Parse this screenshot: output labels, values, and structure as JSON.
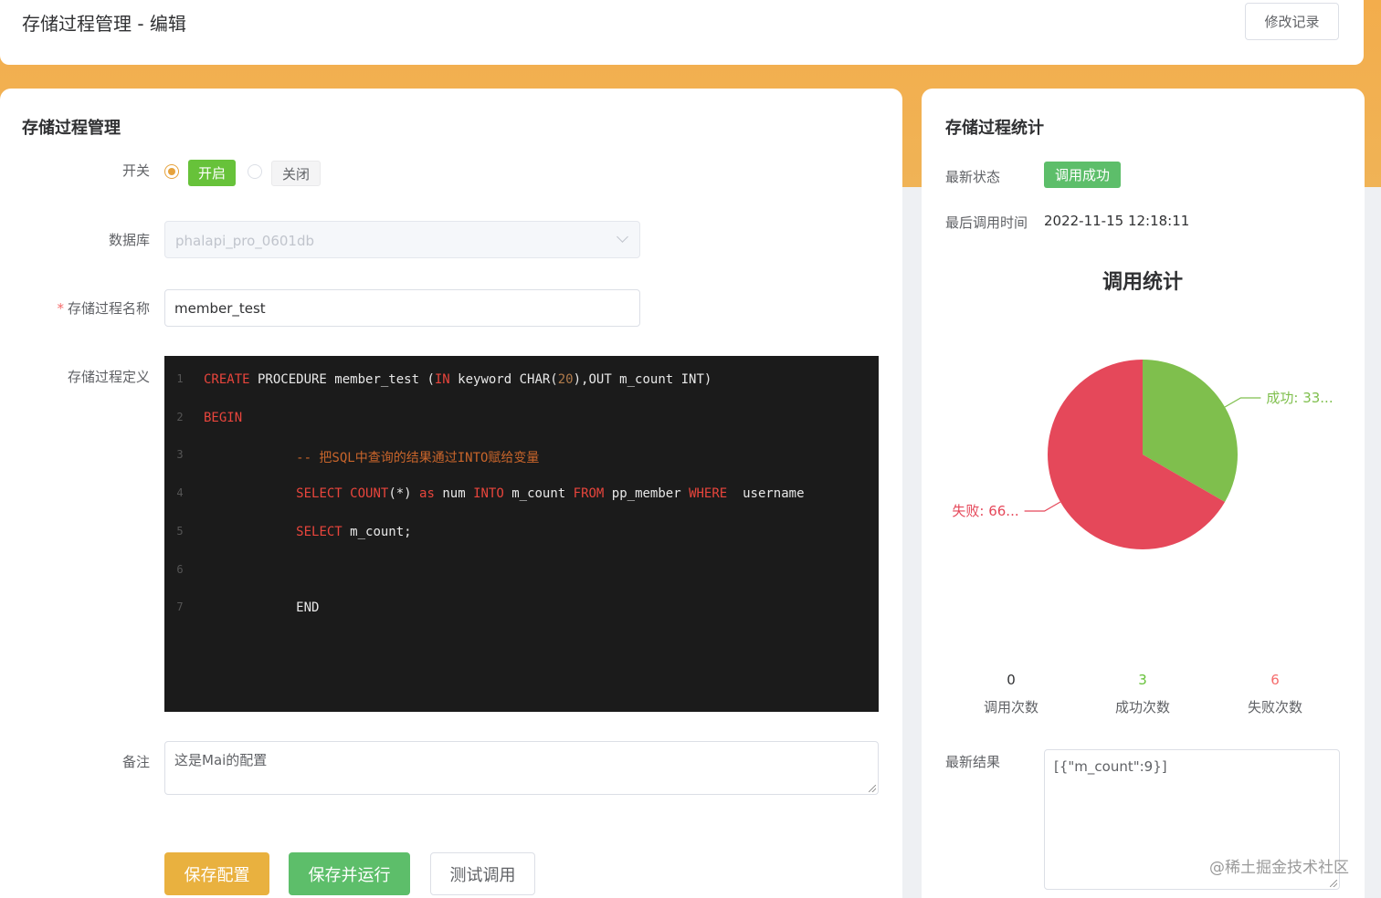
{
  "header": {
    "title": "存储过程管理 - 编辑",
    "history_label": "修改记录"
  },
  "form": {
    "card_title": "存储过程管理",
    "switch_label": "开关",
    "switch_on": "开启",
    "switch_off": "关闭",
    "switch_value": "开启",
    "database_label": "数据库",
    "database_value": "phalapi_pro_0601db",
    "name_label": "存储过程名称",
    "name_required": "*",
    "name_value": "member_test",
    "definition_label": "存储过程定义",
    "code_lines": [
      [
        {
          "t": "CREATE",
          "c": "kw"
        },
        {
          "t": " PROCEDURE member_test ("
        },
        {
          "t": "IN",
          "c": "kw"
        },
        {
          "t": " keyword CHAR("
        },
        {
          "t": "20",
          "c": "num"
        },
        {
          "t": "),OUT m_count INT)"
        }
      ],
      [
        {
          "t": "BEGIN",
          "c": "kw"
        }
      ],
      [
        {
          "t": "            -- 把SQL中查询的结果通过INTO赋给变量",
          "c": "cm"
        }
      ],
      [
        {
          "t": "            "
        },
        {
          "t": "SELECT",
          "c": "kw"
        },
        {
          "t": " "
        },
        {
          "t": "COUNT",
          "c": "kw"
        },
        {
          "t": "(*) "
        },
        {
          "t": "as",
          "c": "kw"
        },
        {
          "t": " num "
        },
        {
          "t": "INTO",
          "c": "kw"
        },
        {
          "t": " m_count "
        },
        {
          "t": "FROM",
          "c": "kw"
        },
        {
          "t": " pp_member "
        },
        {
          "t": "WHERE",
          "c": "kw"
        },
        {
          "t": "  username"
        }
      ],
      [
        {
          "t": "            "
        },
        {
          "t": "SELECT",
          "c": "kw"
        },
        {
          "t": " m_count;"
        }
      ],
      [
        {
          "t": ""
        }
      ],
      [
        {
          "t": "            END"
        }
      ]
    ],
    "remark_label": "备注",
    "remark_value": "这是Mai的配置",
    "save_label": "保存配置",
    "save_run_label": "保存并运行",
    "test_label": "测试调用"
  },
  "stats": {
    "card_title": "存储过程统计",
    "status_label": "最新状态",
    "status_value": "调用成功",
    "last_time_label": "最后调用时间",
    "last_time_value": "2022-11-15 12:18:11",
    "counters": [
      {
        "value": "0",
        "label": "调用次数",
        "color": "#303133"
      },
      {
        "value": "3",
        "label": "成功次数",
        "color": "#67c23a"
      },
      {
        "value": "6",
        "label": "失败次数",
        "color": "#f56c6c"
      }
    ],
    "result_label": "最新结果",
    "result_value": "[{\"m_count\":9}]"
  },
  "chart_data": {
    "type": "pie",
    "title": "调用统计",
    "slices": [
      {
        "name": "成功",
        "value": 3,
        "label": "成功: 33...",
        "color": "#7fbf4d"
      },
      {
        "name": "失败",
        "value": 6,
        "label": "失败: 66...",
        "color": "#e5485a"
      }
    ]
  },
  "watermark": "@稀土掘金技术社区"
}
